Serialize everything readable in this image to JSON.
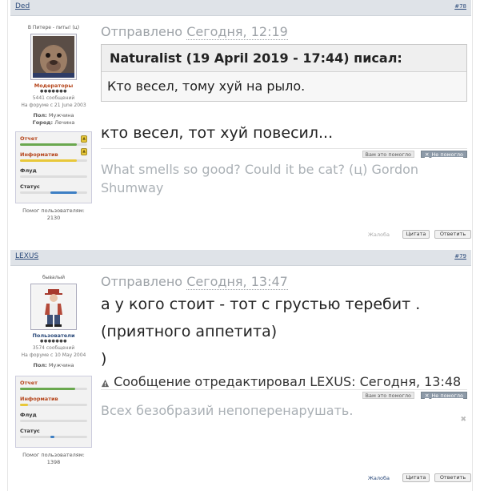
{
  "posts": [
    {
      "author": "Ded",
      "number": "#78",
      "title": "В Питере - питы! (ц)",
      "rank": "Модераторы",
      "rank_dots": "●●●●●●●",
      "messages": "5441 сообщений",
      "joined": "На форуме с 21 June 2003",
      "gender_label": "Пол:",
      "gender": "Мужчина",
      "city_label": "Город:",
      "city": "Лечина",
      "stats": [
        {
          "label": "Отчет",
          "value": 0.85,
          "color": "#6aa84f"
        },
        {
          "label": "Информатив",
          "value": 0.85,
          "color": "#e8c83a"
        },
        {
          "label": "Флуд",
          "value": 0.0,
          "color": "#6aa84f"
        },
        {
          "label": "Статус",
          "value": 0.45,
          "color": "#3d7fc4"
        }
      ],
      "helped_label": "Помог пользователям:",
      "helped": "2130",
      "sent_label": "Отправлено",
      "sent_time": "Сегодня, 12:19",
      "quote_head": "Naturalist (19 April 2019 - 17:44) писал:",
      "quote_body": "Кто весел, тому хуй на рыло.",
      "message": "кто весел, тот хуй повесил...",
      "rate_yes": "Вам это помогло",
      "rate_no": "Не помогло",
      "signature": "What smells so good? Could it be cat? (ц) Gordon Shumway",
      "report": "Жалоба",
      "quote_btn": "Цитата",
      "reply_btn": "Ответить"
    },
    {
      "author": "LEXUS",
      "number": "#79",
      "title": "бывалый",
      "rank": "Пользователи",
      "rank_dots": "●●●●●●●",
      "messages": "3574 сообщений",
      "joined": "На форуме с 10 May 2004",
      "gender_label": "Пол:",
      "gender": "Мужчина",
      "stats": [
        {
          "label": "Отчет",
          "value": 0.82,
          "color": "#6aa84f"
        },
        {
          "label": "Информатив",
          "value": 0.12,
          "color": "#e8c83a"
        },
        {
          "label": "Флуд",
          "value": 0.0,
          "color": "#6aa84f"
        },
        {
          "label": "Статус",
          "value": 0.06,
          "color": "#3d7fc4"
        }
      ],
      "helped_label": "Помог пользователям:",
      "helped": "1398",
      "sent_label": "Отправлено",
      "sent_time": "Сегодня, 13:47",
      "message_lines": [
        "а у кого стоит - тот с грустью теребит .",
        "(приятного аппетита)",
        ")"
      ],
      "edited": "Сообщение отредактировал LEXUS: Сегодня, 13:48",
      "rate_yes": "Вам это помогло",
      "rate_no": "Не помогло",
      "signature": "Всех безобразий непоперенарушать.",
      "report": "Жалоба",
      "quote_btn": "Цитата",
      "reply_btn": "Ответить"
    }
  ]
}
